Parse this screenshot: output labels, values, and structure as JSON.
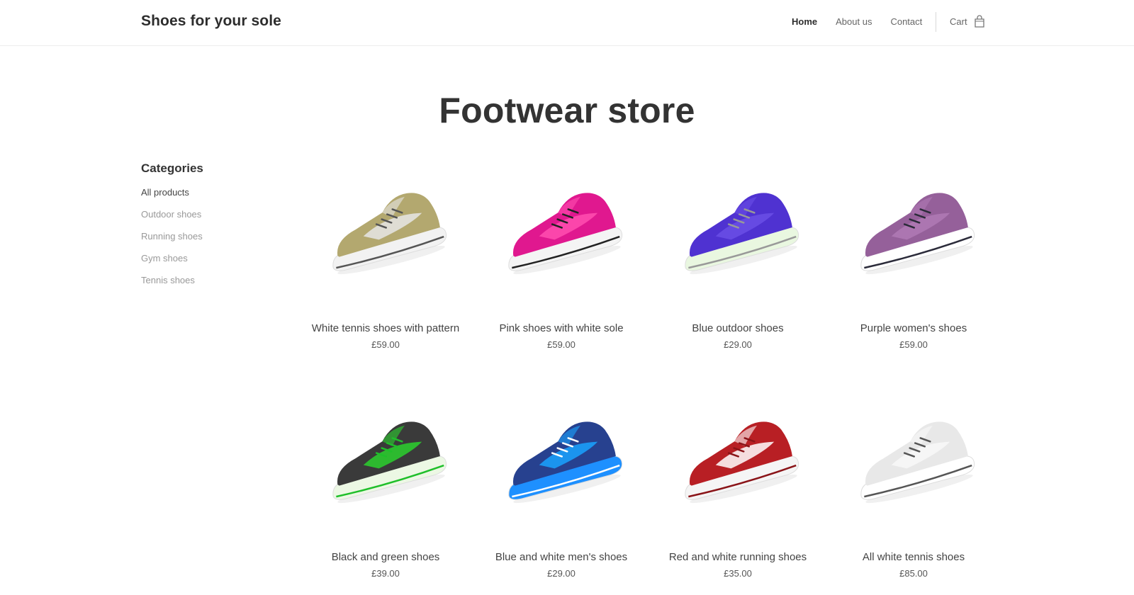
{
  "header": {
    "brand": "Shoes for your sole",
    "nav": [
      "Home",
      "About us",
      "Contact"
    ],
    "active_nav": "Home",
    "cart_label": "Cart",
    "cart_icon": "shopping-bag-icon"
  },
  "hero": {
    "title": "Footwear store"
  },
  "sidebar": {
    "heading": "Categories",
    "items": [
      "All products",
      "Outdoor shoes",
      "Running shoes",
      "Gym shoes",
      "Tennis shoes"
    ],
    "active_item": "All products"
  },
  "products": [
    {
      "name": "White tennis shoes with pattern",
      "price": "£59.00",
      "colors": {
        "upper": "#b3a86f",
        "accent": "#e6e6e6",
        "sole": "#f2f2f2",
        "trim": "#555555"
      }
    },
    {
      "name": "Pink shoes with white sole",
      "price": "£59.00",
      "colors": {
        "upper": "#e0188f",
        "accent": "#ff4fb0",
        "sole": "#f4f4f4",
        "trim": "#222222"
      }
    },
    {
      "name": "Blue outdoor shoes",
      "price": "£29.00",
      "colors": {
        "upper": "#4f32d1",
        "accent": "#6a4fe6",
        "sole": "#e9f7e0",
        "trim": "#999999"
      }
    },
    {
      "name": "Purple women's shoes",
      "price": "£59.00",
      "colors": {
        "upper": "#95609a",
        "accent": "#b07ab5",
        "sole": "#ffffff",
        "trim": "#2b2b3a"
      }
    },
    {
      "name": "Black and green shoes",
      "price": "£39.00",
      "colors": {
        "upper": "#3a3a3a",
        "accent": "#2bd12e",
        "sole": "#ecf8e4",
        "trim": "#1fbf2a"
      }
    },
    {
      "name": "Blue and white men's shoes",
      "price": "£29.00",
      "colors": {
        "upper": "#27418f",
        "accent": "#1aa3ff",
        "sole": "#1e90ff",
        "trim": "#ffffff"
      }
    },
    {
      "name": "Red and white running shoes",
      "price": "£35.00",
      "colors": {
        "upper": "#b81f24",
        "accent": "#ffffff",
        "sole": "#f5f5f5",
        "trim": "#8a1418"
      }
    },
    {
      "name": "All white tennis shoes",
      "price": "£85.00",
      "colors": {
        "upper": "#e8e8e8",
        "accent": "#f8f8f8",
        "sole": "#ffffff",
        "trim": "#555555"
      }
    }
  ]
}
